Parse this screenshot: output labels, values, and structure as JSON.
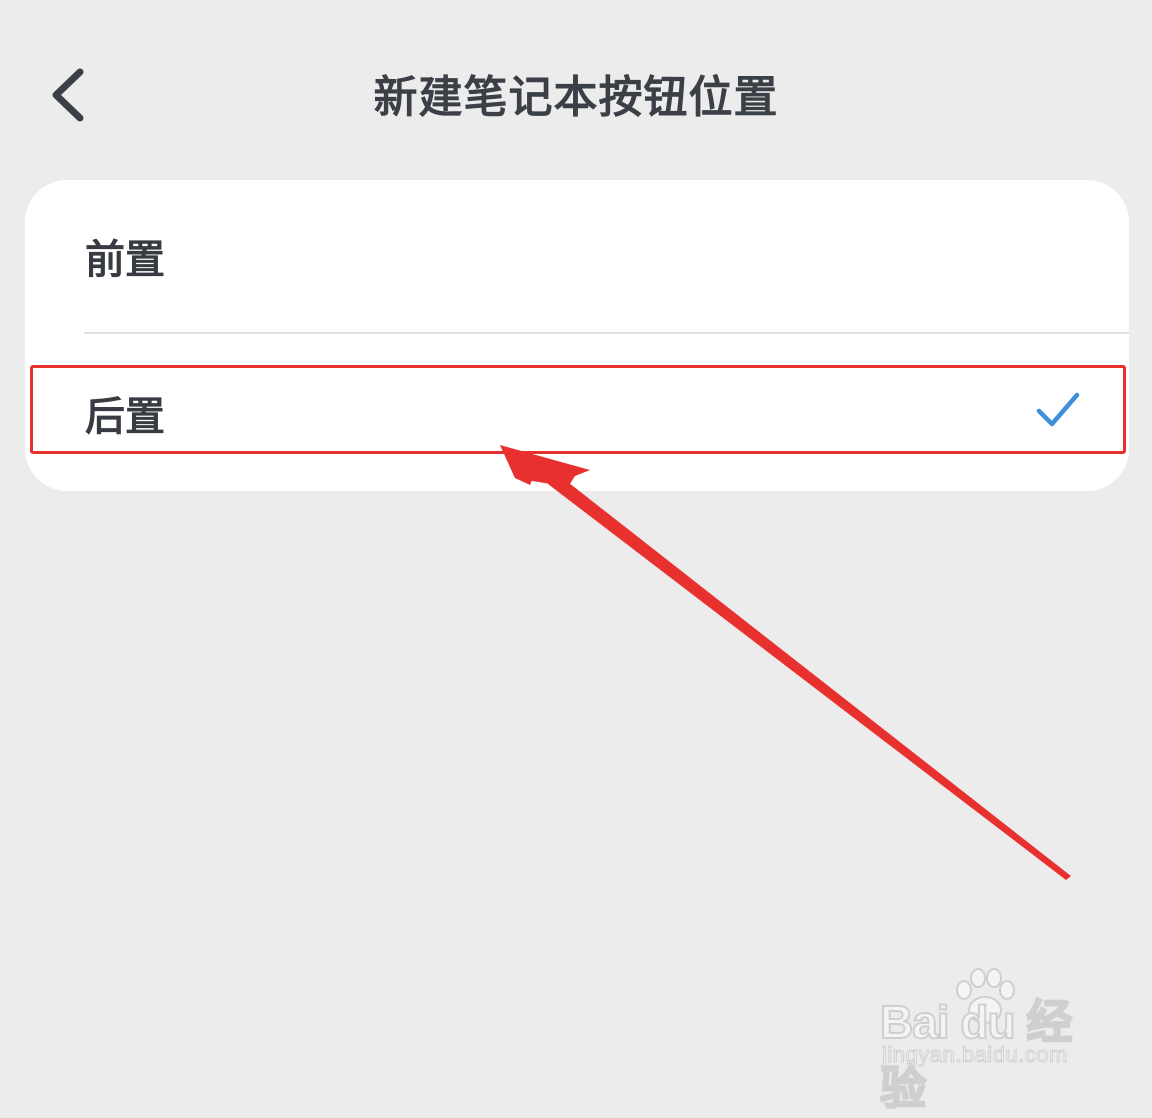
{
  "header": {
    "title": "新建笔记本按钮位置",
    "back_icon": "chevron-left-icon"
  },
  "options": [
    {
      "label": "前置",
      "selected": false
    },
    {
      "label": "后置",
      "selected": true
    }
  ],
  "selection_icon": "checkmark-icon",
  "colors": {
    "background": "#ececed",
    "card": "#ffffff",
    "text": "#383c42",
    "check": "#3f8fdc",
    "annotation": "#e8302e"
  },
  "annotation": {
    "highlight_target": "后置",
    "arrow_icon": "arrow-icon"
  },
  "watermark": {
    "logo_text": "Bai du 经验",
    "url": "jingyan.baidu.com"
  }
}
